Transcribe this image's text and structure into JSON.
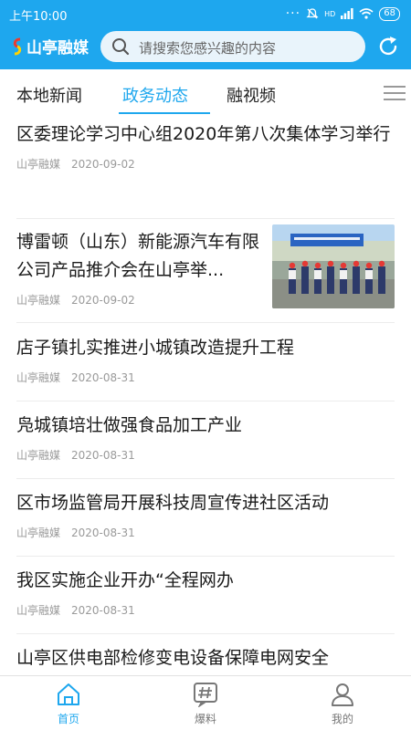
{
  "status_bar": {
    "time": "上午10:00",
    "battery": "68",
    "network": "HD"
  },
  "header": {
    "logo_text": "山亭融媒",
    "search_placeholder": "请搜索您感兴趣的内容",
    "accent_color": "#1ea7ee"
  },
  "tabs": [
    {
      "label": "本地新闻",
      "active": false
    },
    {
      "label": "政务动态",
      "active": true
    },
    {
      "label": "融视频",
      "active": false
    }
  ],
  "news": [
    {
      "title": "区委理论学习中心组2020年第八次集体学习举行",
      "source": "山亭融媒",
      "date": "2020-09-02"
    },
    {
      "title": "博雷顿（山东）新能源汽车有限公司产品推介会在山亭举...",
      "source": "山亭融媒",
      "date": "2020-09-02",
      "has_image": true
    },
    {
      "title": "店子镇扎实推进小城镇改造提升工程",
      "source": "山亭融媒",
      "date": "2020-08-31"
    },
    {
      "title": "凫城镇培壮做强食品加工产业",
      "source": "山亭融媒",
      "date": "2020-08-31"
    },
    {
      "title": "区市场监管局开展科技周宣传进社区活动",
      "source": "山亭融媒",
      "date": "2020-08-31"
    },
    {
      "title": "我区实施企业开办“全程网办",
      "source": "山亭融媒",
      "date": "2020-08-31"
    },
    {
      "title": "山亭区供电部检修变电设备保障电网安全",
      "source": "",
      "date": ""
    }
  ],
  "bottom_nav": [
    {
      "label": "首页",
      "icon": "home-icon",
      "active": true
    },
    {
      "label": "爆料",
      "icon": "hashtag-icon",
      "active": false
    },
    {
      "label": "我的",
      "icon": "user-icon",
      "active": false
    }
  ]
}
